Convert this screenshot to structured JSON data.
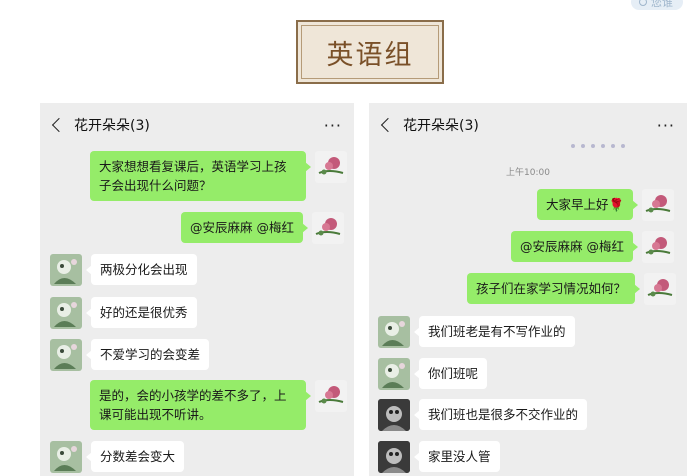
{
  "badge": {
    "text": "您谁"
  },
  "title": "英语组",
  "left_chat": {
    "title": "花开朵朵(3)",
    "more": "···",
    "messages": [
      {
        "side": "out",
        "text": "大家想想看复课后，英语学习上孩子会出现什么问题？"
      },
      {
        "side": "out",
        "text": "@安辰麻麻 @梅红"
      },
      {
        "side": "in",
        "text": "两极分化会出现"
      },
      {
        "side": "in",
        "text": "好的还是很优秀"
      },
      {
        "side": "in",
        "text": "不爱学习的会变差"
      },
      {
        "side": "out",
        "text": "是的，会的小孩学的差不多了，上课可能出现不听讲。"
      },
      {
        "side": "in",
        "text": "分数差会变大"
      }
    ]
  },
  "right_chat": {
    "title": "花开朵朵(3)",
    "more": "···",
    "timestamp": "上午10:00",
    "messages": [
      {
        "side": "out",
        "text": "大家早上好🌹"
      },
      {
        "side": "out",
        "text": "@安辰麻麻 @梅红"
      },
      {
        "side": "out",
        "text": "孩子们在家学习情况如何？"
      },
      {
        "side": "in",
        "text": "我们班老是有不写作业的"
      },
      {
        "side": "in",
        "text": "你们班呢"
      },
      {
        "side": "in",
        "text": "我们班也是很多不交作业的"
      },
      {
        "side": "in",
        "text": "家里没人管"
      }
    ]
  }
}
